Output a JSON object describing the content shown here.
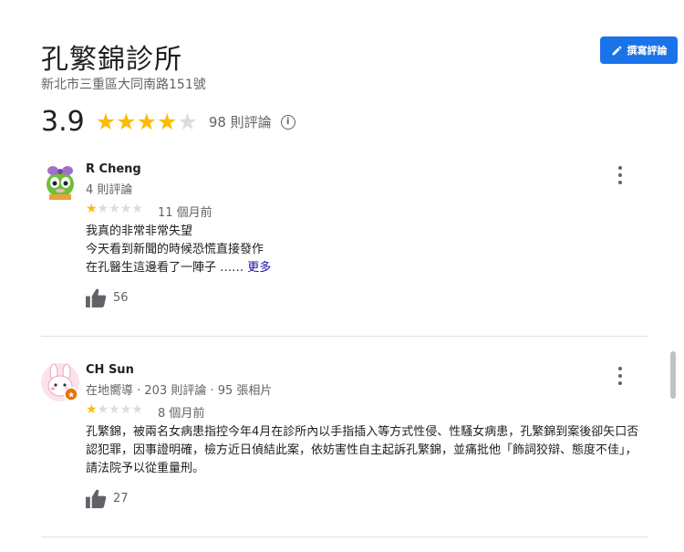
{
  "place": {
    "name": "孔繁錦診所",
    "address": "新北市三重區大同南路151號",
    "write_review_label": "撰寫評論"
  },
  "rating": {
    "score": "3.9",
    "stars_filled": 4,
    "stars_total": 5,
    "count_label": "98 則評論",
    "info_glyph": "i"
  },
  "colors": {
    "star_filled": "#fbbc04",
    "star_empty": "#dadce0",
    "accent": "#1a73e8"
  },
  "reviews": [
    {
      "name": "R Cheng",
      "meta": "4 則評論",
      "stars": 1,
      "time": "11 個月前",
      "lines": [
        "我真的非常非常失望",
        "今天看到新聞的時候恐慌直接發作",
        "在孔醫生這邊看了一陣子 ……"
      ],
      "more_label": "更多",
      "likes": "56"
    },
    {
      "name": "CH Sun",
      "meta": "在地嚮導 · 203 則評論 · 95 張相片",
      "stars": 1,
      "time": "8 個月前",
      "lines": [
        "孔繁錦，被兩名女病患指控今年4月在診所內以手指插入等方式性侵、性騷女病患，孔繁錦到案後卻矢口否認犯罪，因事證明確，檢方近日偵結此案，依妨害性自主起訴孔繁錦，並痛批他「飾詞狡辯、態度不佳」，請法院予以從重量刑。"
      ],
      "likes": "27"
    }
  ]
}
